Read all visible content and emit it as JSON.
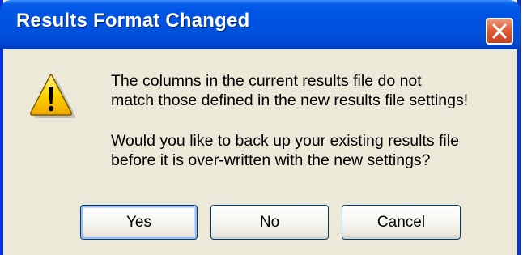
{
  "dialog": {
    "title": "Results Format Changed",
    "message_line_1": "The columns in the current results file do not",
    "message_line_2": "match those defined in the new results file settings!",
    "message_line_3": "Would you like to back up your existing results file",
    "message_line_4": "before it is over-written with the new settings?",
    "icon": "warning-icon",
    "close_icon": "close-icon"
  },
  "buttons": {
    "yes_label": "Yes",
    "no_label": "No",
    "cancel_label": "Cancel"
  },
  "colors": {
    "titlebar": "#0055e5",
    "window_frame": "#0831d9",
    "dialog_body": "#ece9d8",
    "close_button": "#e0603a",
    "warning_yellow": "#ffd200"
  }
}
